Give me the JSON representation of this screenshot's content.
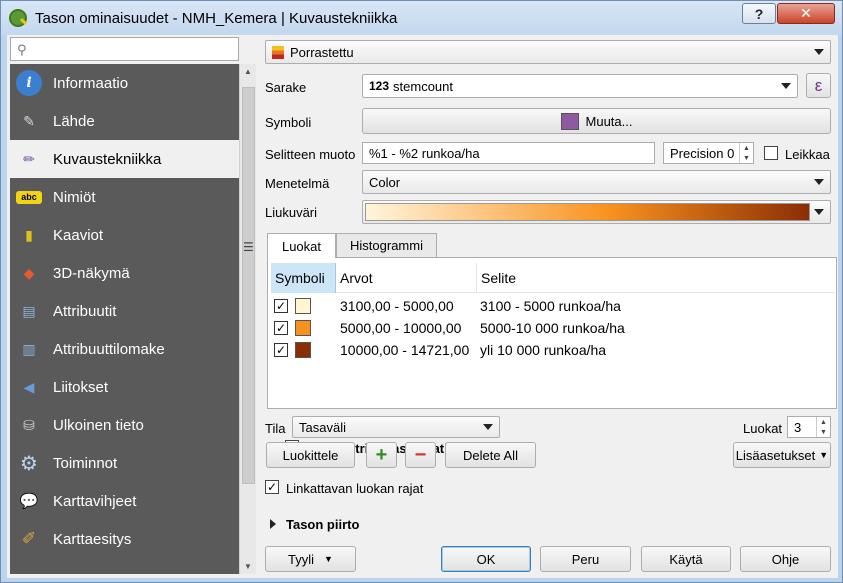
{
  "window": {
    "title": "Tason ominaisuudet - NMH_Kemera | Kuvaustekniikka",
    "help_label": "?",
    "close_label": "✕"
  },
  "sidebar": {
    "search_placeholder": "",
    "items": [
      {
        "label": "Informaatio",
        "icon": "info-icon"
      },
      {
        "label": "Lähde",
        "icon": "wrench-icon"
      },
      {
        "label": "Kuvaustekniikka",
        "icon": "paintbrush-icon",
        "active": true
      },
      {
        "label": "Nimiöt",
        "icon": "abc-label-icon"
      },
      {
        "label": "Kaaviot",
        "icon": "diagram-icon"
      },
      {
        "label": "3D-näkymä",
        "icon": "cube-icon"
      },
      {
        "label": "Attribuutit",
        "icon": "table-icon"
      },
      {
        "label": "Attribuuttilomake",
        "icon": "form-icon"
      },
      {
        "label": "Liitokset",
        "icon": "join-icon"
      },
      {
        "label": "Ulkoinen tieto",
        "icon": "database-icon"
      },
      {
        "label": "Toiminnot",
        "icon": "gear-icon"
      },
      {
        "label": "Karttavihjeet",
        "icon": "speech-bubble-icon"
      },
      {
        "label": "Karttaesitys",
        "icon": "brush-icon"
      }
    ]
  },
  "renderer": {
    "type_value": "Porrastettu",
    "column_label": "Sarake",
    "column_prefix": "123",
    "column_value": "stemcount",
    "expr_label": "ε",
    "symbol_label": "Symboli",
    "symbol_button": "Muuta...",
    "symbol_color": "#8e5aa2",
    "legend_format_label": "Selitteen muoto",
    "legend_format_value": "%1 - %2 runkoa/ha",
    "precision_label": "Precision",
    "precision_value": "0",
    "trim_label": "Leikkaa",
    "method_label": "Menetelmä",
    "method_value": "Color",
    "ramp_label": "Liukuväri",
    "ramp_start": "#fff5dc",
    "ramp_end": "#8b2e05"
  },
  "tabs": {
    "classes": "Luokat",
    "histogram": "Histogrammi"
  },
  "classes_table": {
    "headers": {
      "symbol": "Symboli",
      "values": "Arvot",
      "legend": "Selite"
    },
    "rows": [
      {
        "checked": "✓",
        "color": "#fff6cf",
        "values": "3100,00 - 5000,00",
        "legend": "3100 - 5000 runkoa/ha"
      },
      {
        "checked": "✓",
        "color": "#f8921e",
        "values": "5000,00 - 10000,00",
        "legend": "5000-10 000 runkoa/ha"
      },
      {
        "checked": "✓",
        "color": "#8b2e05",
        "values": "10000,00 - 14721,00",
        "legend": "yli 10 000 runkoa/ha"
      }
    ]
  },
  "mode": {
    "label": "Tila",
    "value": "Tasaväli",
    "classes_label": "Luokat",
    "classes_value": "3"
  },
  "symmetric_label": "Symmetric Classification",
  "buttons": {
    "classify": "Luokittele",
    "add": "+",
    "remove": "−",
    "delete_all": "Delete All",
    "advanced": "Lisäasetukset"
  },
  "link_bounds_label": "Linkattavan luokan rajat",
  "layer_rendering_label": "Tason piirto",
  "dialog_buttons": {
    "style": "Tyyli",
    "ok": "OK",
    "cancel": "Peru",
    "apply": "Käytä",
    "help": "Ohje"
  }
}
